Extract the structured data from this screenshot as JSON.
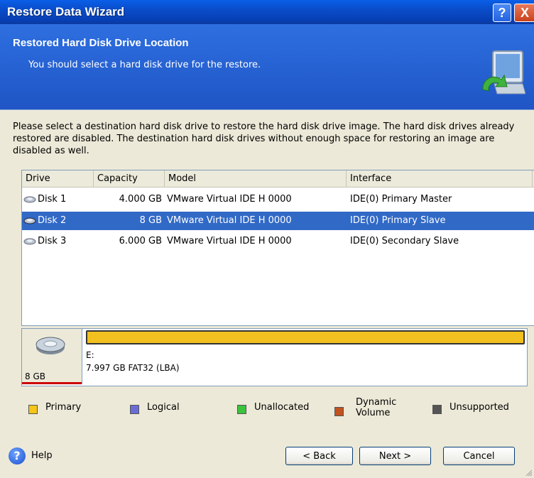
{
  "window": {
    "title": "Restore Data Wizard",
    "help_glyph": "?",
    "close_glyph": "X"
  },
  "banner": {
    "title": "Restored Hard Disk Drive Location",
    "subtitle": "You should select a hard disk drive for the restore.",
    "icon": "computer-restore-icon"
  },
  "description": "Please select a destination hard disk drive to restore the hard disk drive image. The hard disk drives already restored are disabled. The destination hard disk drives without enough space for restoring an image are disabled as well.",
  "drive_table": {
    "columns": [
      "Drive",
      "Capacity",
      "Model",
      "Interface"
    ],
    "rows": [
      {
        "drive": "Disk 1",
        "capacity": "4.000 GB",
        "model": "VMware Virtual IDE H 0000",
        "interface": "IDE(0) Primary Master",
        "selected": false
      },
      {
        "drive": "Disk 2",
        "capacity": "8 GB",
        "model": "VMware Virtual IDE H 0000",
        "interface": "IDE(0) Primary Slave",
        "selected": true
      },
      {
        "drive": "Disk 3",
        "capacity": "6.000 GB",
        "model": "VMware Virtual IDE H 0000",
        "interface": "IDE(0) Secondary Slave",
        "selected": false
      }
    ]
  },
  "partition": {
    "disk_size": "8 GB",
    "name": "E:",
    "info": "7.997 GB  FAT32 (LBA)",
    "bar_color": "#F2C11F"
  },
  "legend": [
    {
      "label": "Primary",
      "color": "#F5C518"
    },
    {
      "label": "Logical",
      "color": "#6B6BD6"
    },
    {
      "label": "Unallocated",
      "color": "#3CC33C"
    },
    {
      "label": "Dynamic Volume",
      "color": "#C0531E"
    },
    {
      "label": "Unsupported",
      "color": "#555555"
    }
  ],
  "footer": {
    "help_label": "Help",
    "back_label": "< Back",
    "next_label": "Next >",
    "cancel_label": "Cancel"
  },
  "colors": {
    "selection": "#3169C6",
    "banner": "#2E6FE0",
    "window_bg": "#ECE9D8"
  }
}
